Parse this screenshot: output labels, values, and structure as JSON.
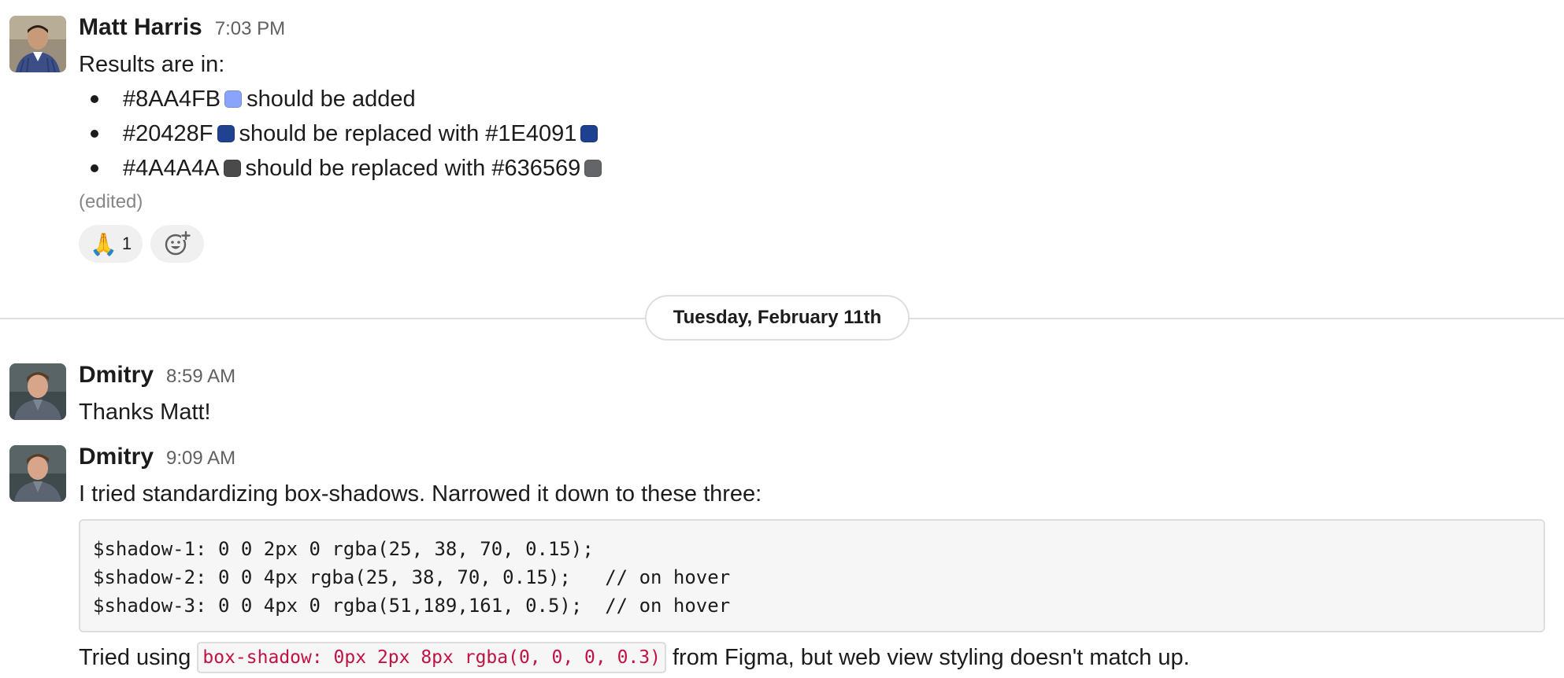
{
  "messages": [
    {
      "sender": "Matt Harris",
      "time": "7:03 PM",
      "intro": "Results are in:",
      "bullets": [
        {
          "color1": "#8AA4FB",
          "swatch1": "#8AA4FB",
          "text": "should be added"
        },
        {
          "color1": "#20428F",
          "swatch1": "#20428F",
          "text": "should be replaced with",
          "color2": "#1E4091",
          "swatch2": "#1E4091"
        },
        {
          "color1": "#4A4A4A",
          "swatch1": "#4A4A4A",
          "text": "should be replaced with",
          "color2": "#636569",
          "swatch2": "#636569"
        }
      ],
      "edited": "(edited)",
      "reactions": [
        {
          "emoji": "🙏",
          "count": "1"
        }
      ]
    },
    {
      "sender": "Dmitry",
      "time": "8:59 AM",
      "text": "Thanks Matt!"
    },
    {
      "sender": "Dmitry",
      "time": "9:09 AM",
      "text": "I tried standardizing box-shadows. Narrowed it down to these three:",
      "code_lines": [
        "$shadow-1: 0 0 2px 0 rgba(25, 38, 70, 0.15);",
        "$shadow-2: 0 0 4px rgba(25, 38, 70, 0.15);   // on hover",
        "$shadow-3: 0 0 4px 0 rgba(51,189,161, 0.5);  // on hover"
      ],
      "followup_before": "Tried using",
      "followup_code": "box-shadow: 0px 2px 8px rgba(0, 0, 0, 0.3)",
      "followup_after": "from Figma, but web view styling doesn't match up."
    }
  ],
  "date_divider": "Tuesday, February 11th"
}
